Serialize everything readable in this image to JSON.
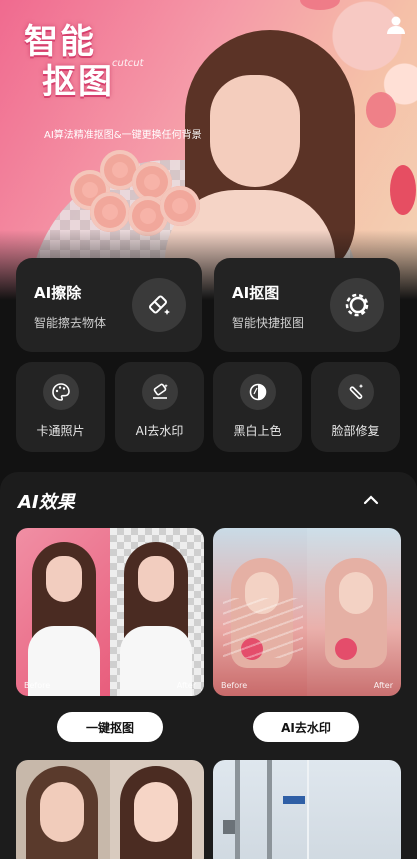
{
  "banner": {
    "title_line1": "智能",
    "title_line2": "抠图",
    "subtitle_en": "cutcut",
    "description": "AI算法精准抠图&一键更换任何背景"
  },
  "features_large": [
    {
      "title": "AI擦除",
      "subtitle": "智能擦去物体",
      "icon": "eraser-magic-icon"
    },
    {
      "title": "AI抠图",
      "subtitle": "智能快捷抠图",
      "icon": "cutout-circle-icon"
    }
  ],
  "features_small": [
    {
      "label": "卡通照片",
      "icon": "palette-icon"
    },
    {
      "label": "AI去水印",
      "icon": "watermark-eraser-icon"
    },
    {
      "label": "黑白上色",
      "icon": "contrast-icon"
    },
    {
      "label": "脸部修复",
      "icon": "magic-wand-icon"
    }
  ],
  "effects": {
    "title": "AI效果",
    "items": [
      {
        "before": "Before",
        "after": "After",
        "button": "一键抠图"
      },
      {
        "before": "Before",
        "after": "After",
        "button": "AI去水印"
      }
    ]
  },
  "colors": {
    "background": "#121212",
    "card": "#232323",
    "accent_pink": "#f06a8f"
  }
}
